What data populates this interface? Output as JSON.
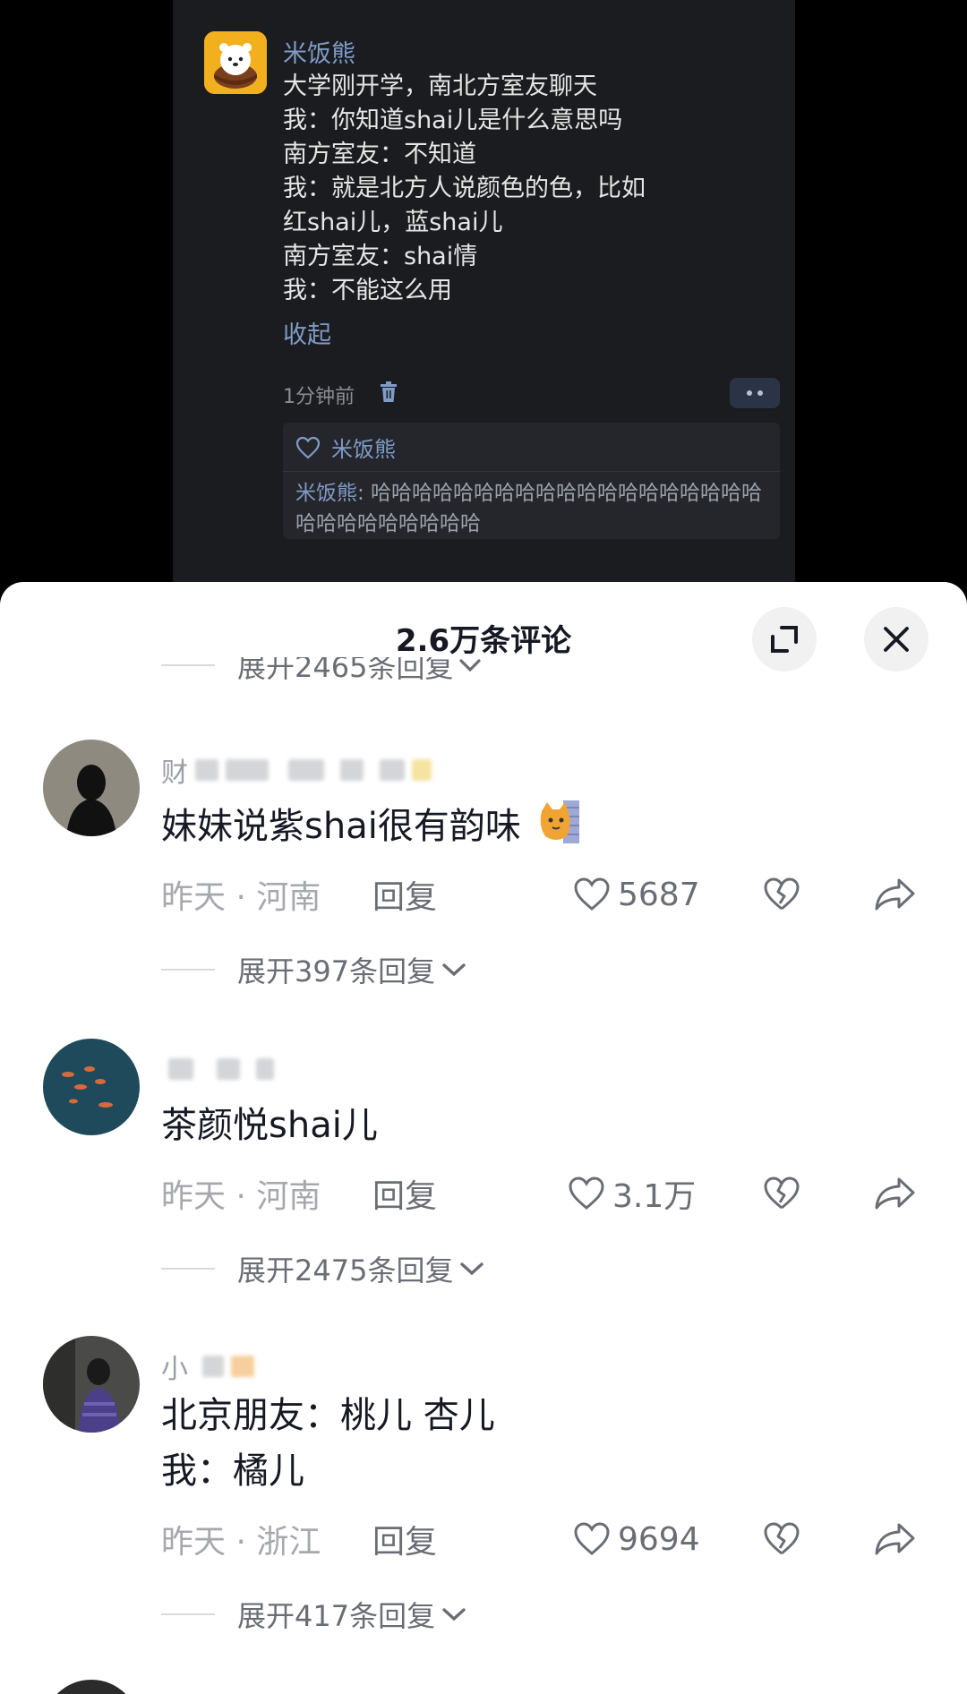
{
  "post": {
    "author": "米饭熊",
    "lines": [
      "大学刚开学，南北方室友聊天",
      "我：你知道shai儿是什么意思吗",
      "南方室友：不知道",
      "我：就是北方人说颜色的色，比如",
      "红shai儿，蓝shai儿",
      "南方室友：shai情",
      "我：不能这么用"
    ],
    "collapse": "收起",
    "time": "1分钟前",
    "liked_by": "米饭熊",
    "reply_name": "米饭熊",
    "reply_text": ": 哈哈哈哈哈哈哈哈哈哈哈哈哈哈哈哈哈哈哈哈哈哈哈哈哈哈哈哈"
  },
  "sheet": {
    "title": "2.6万条评论",
    "top_expand": "展开2465条回复"
  },
  "comments": [
    {
      "name_visible": "财",
      "lines": [
        "妹妹说紫shai很有韵味"
      ],
      "time_loc": "昨天 · 河南",
      "reply": "回复",
      "likes": "5687",
      "expand": "展开397条回复"
    },
    {
      "name_visible": "",
      "lines": [
        "茶颜悦shai儿"
      ],
      "time_loc": "昨天 · 河南",
      "reply": "回复",
      "likes": "3.1万",
      "expand": "展开2475条回复"
    },
    {
      "name_visible": "小",
      "lines": [
        "北京朋友：桃儿 杏儿",
        "我：橘儿"
      ],
      "time_loc": "昨天 · 浙江",
      "reply": "回复",
      "likes": "9694",
      "expand": "展开417条回复"
    }
  ],
  "colors": {
    "link_blue": "#7f9bc7",
    "text_dark": "#161823",
    "text_gray": "#a6a8ae",
    "inner_avatar_bg": "#f2b01e"
  }
}
